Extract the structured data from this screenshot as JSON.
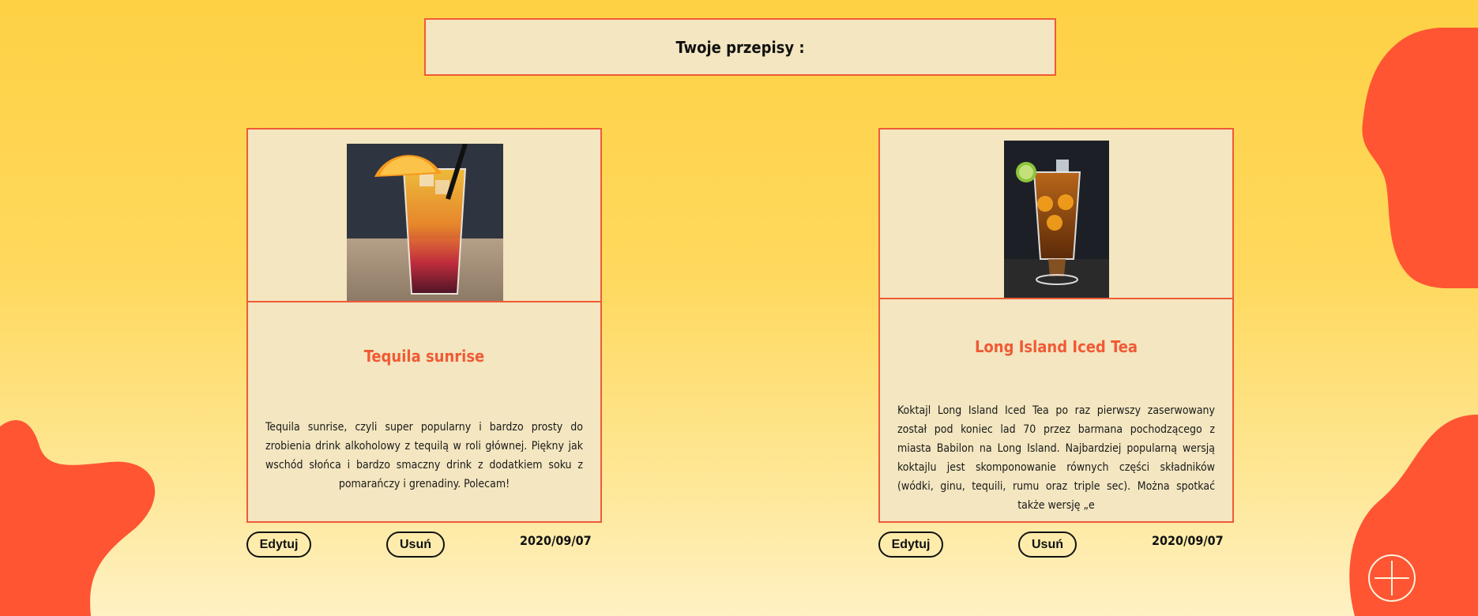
{
  "header": {
    "title": "Twoje przepisy :"
  },
  "recipes": [
    {
      "title": "Tequila sunrise",
      "description": "Tequila sunrise, czyli super popularny i bardzo prosty do zrobienia drink alkoholowy z tequilą w roli głównej. Piękny jak wschód słońca i bardzo smaczny drink z dodatkiem soku z pomarańczy i grenadiny. Polecam!",
      "edit_label": "Edytuj",
      "delete_label": "Usuń",
      "date": "2020/09/07"
    },
    {
      "title": "Long Island Iced Tea",
      "description": "Koktajl Long Island Iced Tea po raz pierwszy zaserwowany został pod koniec lad 70 przez barmana pochodzącego z miasta Babilon na Long Island. Najbardziej popularną wersją koktajlu jest skomponowanie równych części składników (wódki, ginu, tequili, rumu oraz triple sec). Można spotkać także wersję „e",
      "edit_label": "Edytuj",
      "delete_label": "Usuń",
      "date": "2020/09/07"
    }
  ],
  "add_button": {
    "icon": "plus-icon"
  },
  "colors": {
    "accent": "#f05a36",
    "card_bg": "#f3e6c0",
    "blob": "#ff5533"
  }
}
